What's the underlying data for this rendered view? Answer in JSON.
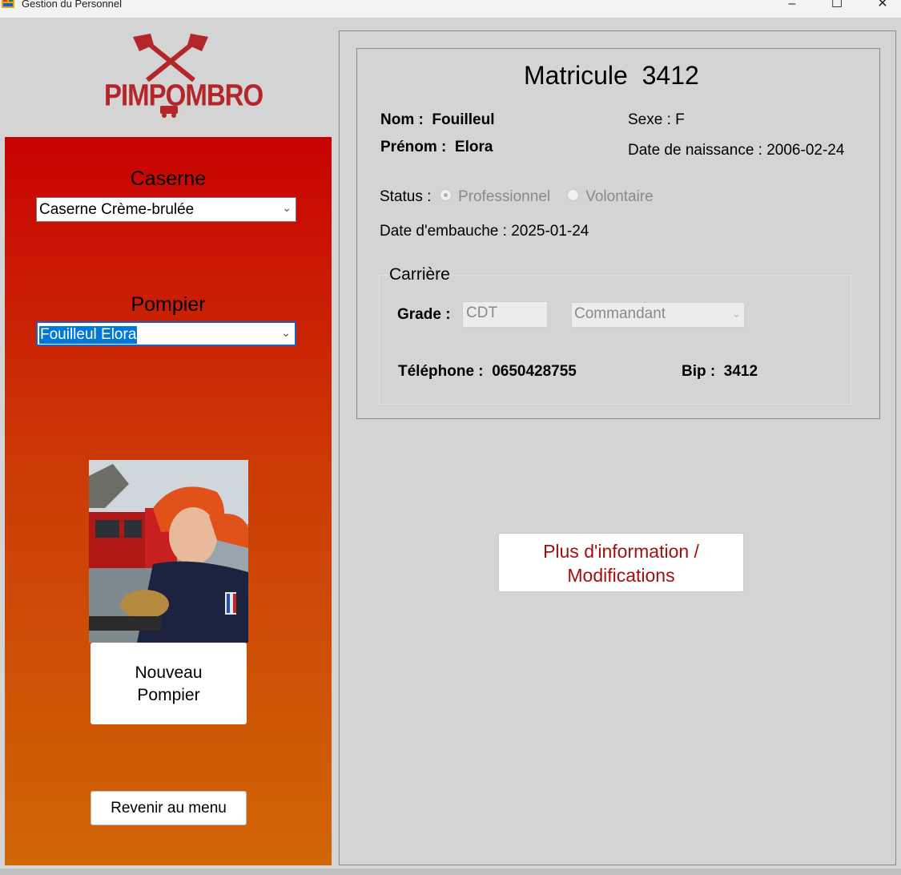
{
  "window": {
    "title": "Gestion du Personnel",
    "minimize": "–",
    "maximize": "☐",
    "close": "✕"
  },
  "logo": {
    "text": "PIMPOMBRO"
  },
  "sidebar": {
    "caserne_label": "Caserne",
    "caserne_value": "Caserne Crème-brulée",
    "pompier_label": "Pompier",
    "pompier_value": "Fouilleul Elora",
    "chevron": "⌄",
    "new_button_line1": "Nouveau",
    "new_button_line2": "Pompier",
    "menu_button": "Revenir au menu"
  },
  "details": {
    "matricule_label": "Matricule",
    "matricule_value": "3412",
    "nom_label": "Nom :",
    "nom_value": "Fouilleul",
    "prenom_label": "Prénom :",
    "prenom_value": "Elora",
    "sexe_label": "Sexe :",
    "sexe_value": "F",
    "naissance_label": "Date de naissance :",
    "naissance_value": "2006-02-24",
    "status_label": "Status :",
    "status_options": [
      "Professionnel",
      "Volontaire"
    ],
    "status_selected": "Professionnel",
    "embauche_label": "Date d'embauche :",
    "embauche_value": "2025-01-24",
    "carriere": {
      "legend": "Carrière",
      "grade_label": "Grade :",
      "grade_code": "CDT",
      "grade_name": "Commandant",
      "telephone_label": "Téléphone :",
      "telephone_value": "0650428755",
      "bip_label": "Bip :",
      "bip_value": "3412"
    }
  },
  "more_button_line1": "Plus d'information /",
  "more_button_line2": "Modifications",
  "colors": {
    "sidebar_top": "#c80202",
    "sidebar_bottom": "#d06605",
    "brand_red": "#b3262a",
    "button_text_red": "#a01010"
  }
}
